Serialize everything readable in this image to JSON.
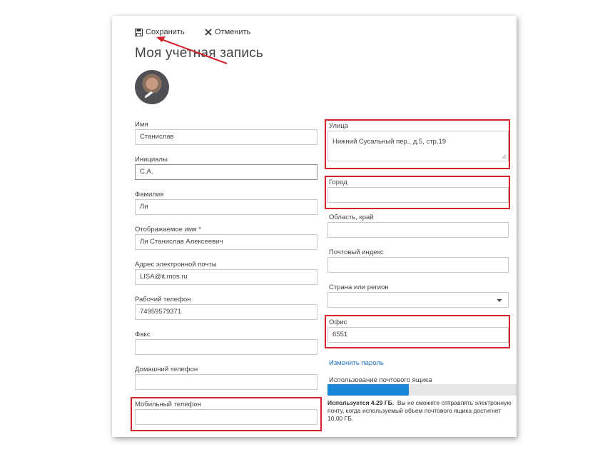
{
  "toolbar": {
    "save_label": "Сохранить",
    "cancel_label": "Отменить"
  },
  "page": {
    "title": "Моя учетная запись"
  },
  "left_fields": [
    {
      "label": "Имя",
      "value": "Станислав"
    },
    {
      "label": "Инициалы",
      "value": "С.А."
    },
    {
      "label": "Фамилия",
      "value": "Ли"
    },
    {
      "label": "Отображаемое имя *",
      "value": "Ли Станислав Алексеевич"
    },
    {
      "label": "Адрес электронной почты",
      "value": "LISA@it.mos.ru"
    },
    {
      "label": "Рабочий телефон",
      "value": "74959579371"
    },
    {
      "label": "Факс",
      "value": ""
    },
    {
      "label": "Домашний телефон",
      "value": ""
    },
    {
      "label": "Мобильный телефон",
      "value": ""
    }
  ],
  "right_fields": [
    {
      "label": "Улица",
      "value": "Нижний Сусальный пер., д.5, стр.19"
    },
    {
      "label": "Город",
      "value": ""
    },
    {
      "label": "Область, край",
      "value": ""
    },
    {
      "label": "Почтовый индекс",
      "value": ""
    },
    {
      "label": "Страна или регион",
      "value": ""
    },
    {
      "label": "Офис",
      "value": "6551"
    }
  ],
  "change_password_label": "Изменить пароль",
  "mailbox": {
    "label": "Использование почтового ящика",
    "usage_fraction": 0.43,
    "used_text": "Используется 4.29 ГБ.",
    "warning_text": "Вы не сможете отправлять электронную почту, когда используемый объем почтового ящика достигнет 10.00 ГБ."
  },
  "colors": {
    "highlight": "#d2222c",
    "link": "#1a73c8",
    "usage_fill": "#1b86d8"
  }
}
